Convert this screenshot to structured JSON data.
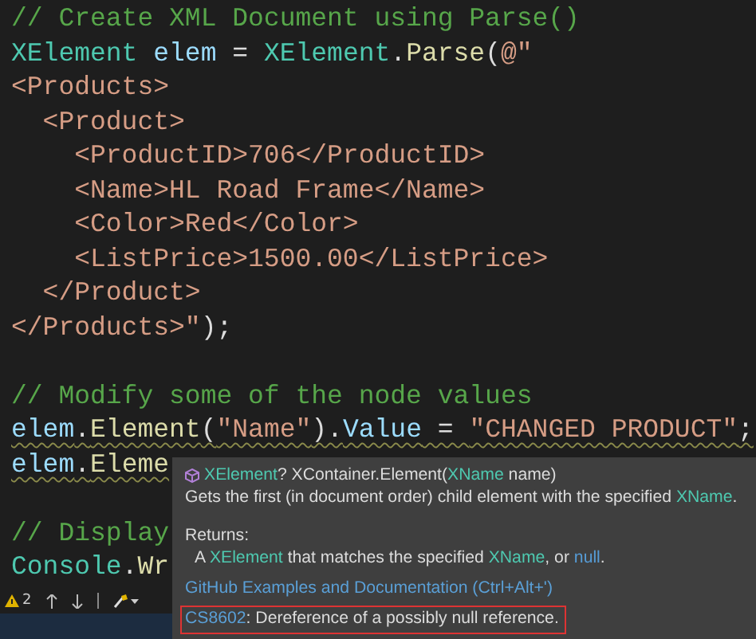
{
  "editor": {
    "lines": [
      {
        "kind": "code",
        "warning": false,
        "tokens": [
          {
            "text": "// Create XML Document using Parse()",
            "kind": "comment"
          }
        ]
      },
      {
        "kind": "code",
        "warning": false,
        "tokens": [
          {
            "text": "XElement",
            "kind": "type"
          },
          {
            "text": " elem",
            "kind": "var"
          },
          {
            "text": " = ",
            "kind": "plain"
          },
          {
            "text": "XElement",
            "kind": "type"
          },
          {
            "text": ".",
            "kind": "plain"
          },
          {
            "text": "Parse",
            "kind": "method"
          },
          {
            "text": "(",
            "kind": "plain"
          },
          {
            "text": "@\"",
            "kind": "string"
          }
        ]
      },
      {
        "kind": "code",
        "warning": false,
        "tokens": [
          {
            "text": "<Products>",
            "kind": "string"
          }
        ]
      },
      {
        "kind": "code",
        "warning": false,
        "tokens": [
          {
            "text": "  <Product>",
            "kind": "string"
          }
        ]
      },
      {
        "kind": "code",
        "warning": false,
        "tokens": [
          {
            "text": "    <ProductID>706</ProductID>",
            "kind": "string"
          }
        ]
      },
      {
        "kind": "code",
        "warning": false,
        "tokens": [
          {
            "text": "    <Name>HL Road Frame</Name>",
            "kind": "string"
          }
        ]
      },
      {
        "kind": "code",
        "warning": false,
        "tokens": [
          {
            "text": "    <Color>Red</Color>",
            "kind": "string"
          }
        ]
      },
      {
        "kind": "code",
        "warning": false,
        "tokens": [
          {
            "text": "    <ListPrice>1500.00</ListPrice>",
            "kind": "string"
          }
        ]
      },
      {
        "kind": "code",
        "warning": false,
        "tokens": [
          {
            "text": "  </Product>",
            "kind": "string"
          }
        ]
      },
      {
        "kind": "code",
        "warning": false,
        "tokens": [
          {
            "text": "</Products>\"",
            "kind": "string"
          },
          {
            "text": ");",
            "kind": "plain"
          }
        ]
      },
      {
        "kind": "blank"
      },
      {
        "kind": "code",
        "warning": false,
        "tokens": [
          {
            "text": "// Modify some of the node values",
            "kind": "comment"
          }
        ]
      },
      {
        "kind": "code",
        "warning": true,
        "tokens": [
          {
            "text": "elem",
            "kind": "var"
          },
          {
            "text": ".",
            "kind": "plain"
          },
          {
            "text": "Element",
            "kind": "method"
          },
          {
            "text": "(",
            "kind": "plain"
          },
          {
            "text": "\"Name\"",
            "kind": "string"
          },
          {
            "text": ").",
            "kind": "plain"
          },
          {
            "text": "Value",
            "kind": "var"
          },
          {
            "text": " = ",
            "kind": "plain"
          },
          {
            "text": "\"CHANGED PRODUCT\"",
            "kind": "string"
          },
          {
            "text": ";",
            "kind": "plain"
          }
        ]
      },
      {
        "kind": "code",
        "warning": true,
        "tokens": [
          {
            "text": "elem",
            "kind": "var"
          },
          {
            "text": ".",
            "kind": "plain"
          },
          {
            "text": "Eleme",
            "kind": "method"
          }
        ]
      },
      {
        "kind": "blank"
      },
      {
        "kind": "code",
        "warning": false,
        "tokens": [
          {
            "text": "// Display",
            "kind": "comment"
          }
        ]
      },
      {
        "kind": "code",
        "warning": false,
        "tokens": [
          {
            "text": "Console",
            "kind": "type"
          },
          {
            "text": ".",
            "kind": "plain"
          },
          {
            "text": "Wr",
            "kind": "method"
          }
        ]
      }
    ]
  },
  "status_bar": {
    "warning_count": "2"
  },
  "quick_info": {
    "signature": [
      {
        "text": "XElement",
        "kind": "type"
      },
      {
        "text": "? XContainer.Element(",
        "kind": "text"
      },
      {
        "text": "XName",
        "kind": "type"
      },
      {
        "text": " name)",
        "kind": "text"
      }
    ],
    "summary": [
      {
        "text": "Gets the first (in document order) child element with the specified ",
        "kind": "text"
      },
      {
        "text": "XName",
        "kind": "type"
      },
      {
        "text": ".",
        "kind": "text"
      }
    ],
    "returns_label": "Returns:",
    "returns": [
      {
        "text": "A ",
        "kind": "text"
      },
      {
        "text": "XElement",
        "kind": "type"
      },
      {
        "text": " that matches the specified ",
        "kind": "text"
      },
      {
        "text": "XName",
        "kind": "type"
      },
      {
        "text": ", or ",
        "kind": "text"
      },
      {
        "text": "null",
        "kind": "keyword"
      },
      {
        "text": ".",
        "kind": "text"
      }
    ],
    "link": "GitHub Examples and Documentation (Ctrl+Alt+')",
    "error": {
      "code": "CS8602",
      "message": ": Dereference of a possibly null reference."
    }
  }
}
